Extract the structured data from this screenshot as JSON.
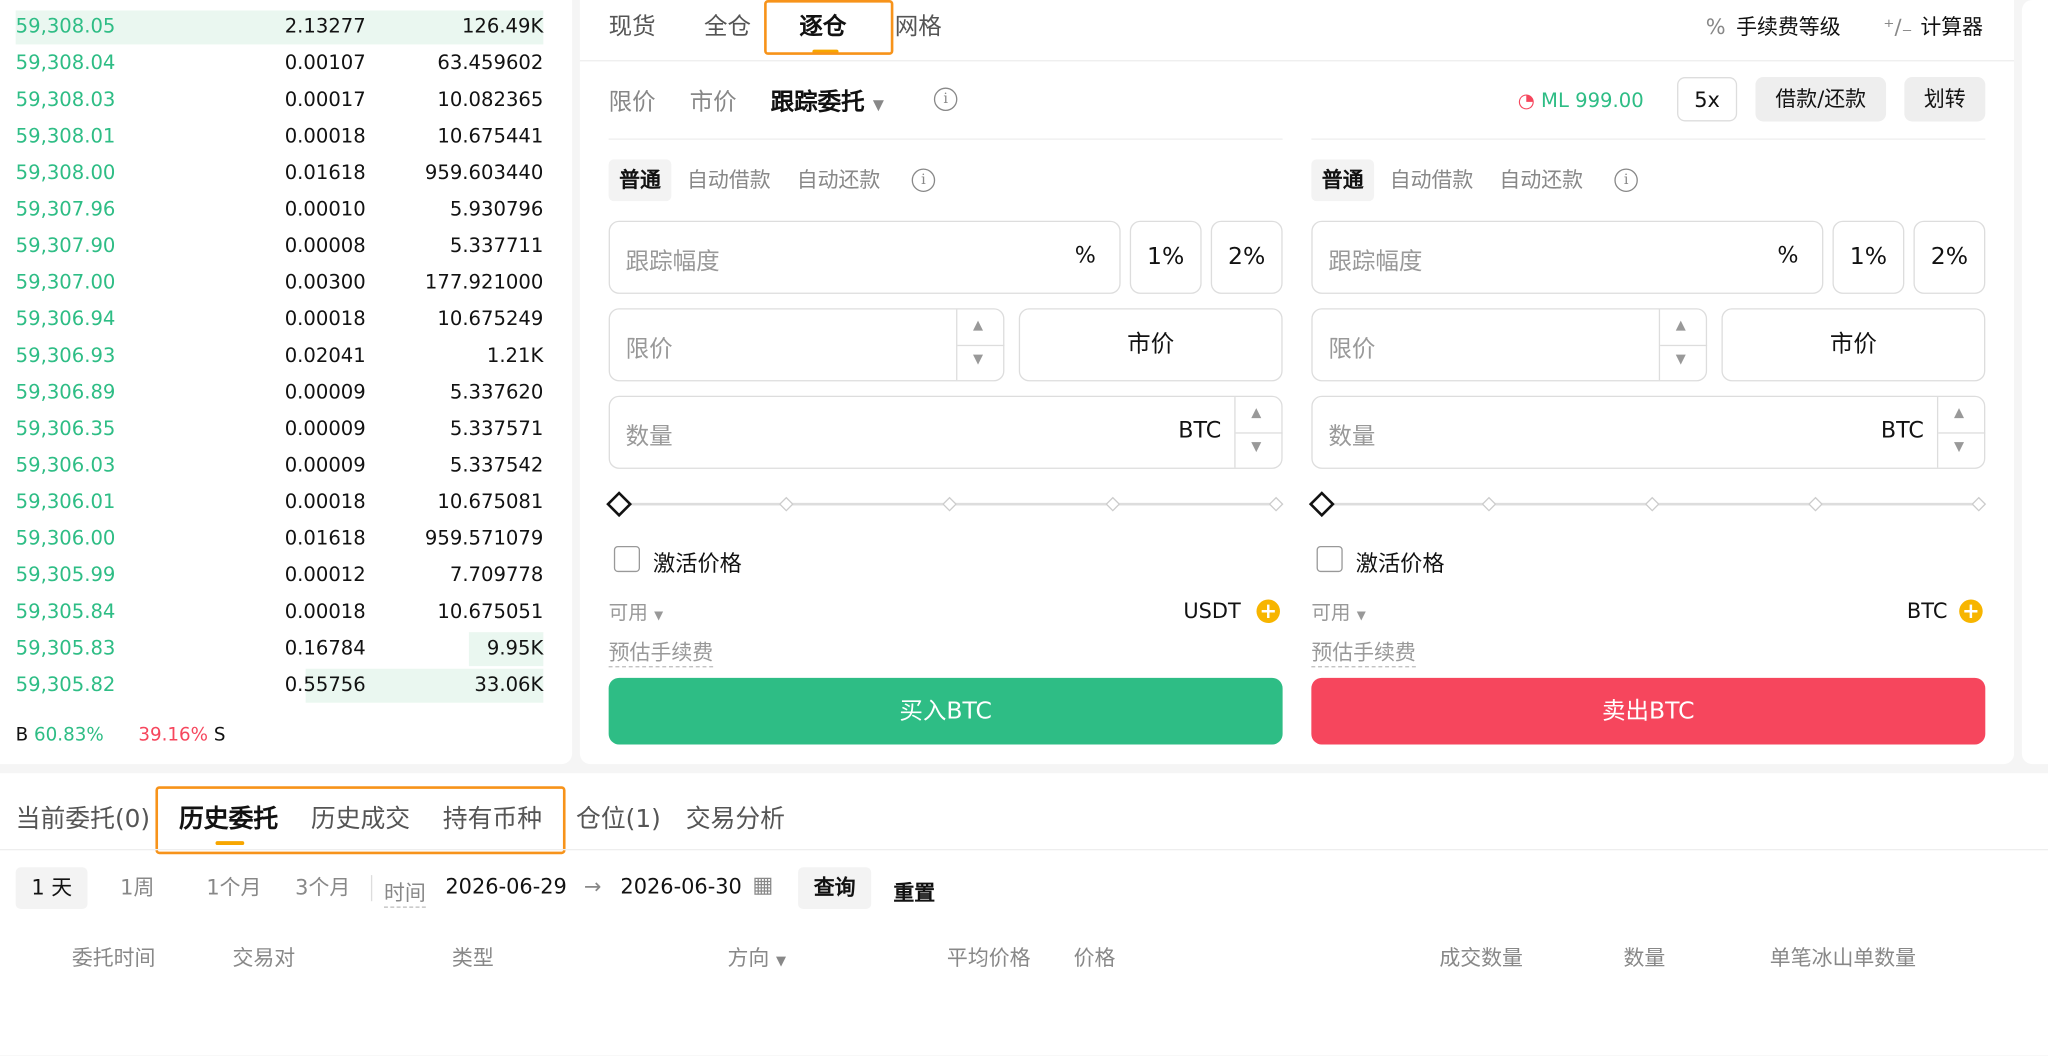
{
  "order_book": {
    "rows": [
      {
        "price": "59,308.05",
        "amount": "2.13277",
        "total": "126.49K",
        "depth": 1.0
      },
      {
        "price": "59,308.04",
        "amount": "0.00107",
        "total": "63.459602",
        "depth": 0
      },
      {
        "price": "59,308.03",
        "amount": "0.00017",
        "total": "10.082365",
        "depth": 0
      },
      {
        "price": "59,308.01",
        "amount": "0.00018",
        "total": "10.675441",
        "depth": 0
      },
      {
        "price": "59,308.00",
        "amount": "0.01618",
        "total": "959.603440",
        "depth": 0
      },
      {
        "price": "59,307.96",
        "amount": "0.00010",
        "total": "5.930796",
        "depth": 0
      },
      {
        "price": "59,307.90",
        "amount": "0.00008",
        "total": "5.337711",
        "depth": 0
      },
      {
        "price": "59,307.00",
        "amount": "0.00300",
        "total": "177.921000",
        "depth": 0
      },
      {
        "price": "59,306.94",
        "amount": "0.00018",
        "total": "10.675249",
        "depth": 0
      },
      {
        "price": "59,306.93",
        "amount": "0.02041",
        "total": "1.21K",
        "depth": 0
      },
      {
        "price": "59,306.89",
        "amount": "0.00009",
        "total": "5.337620",
        "depth": 0
      },
      {
        "price": "59,306.35",
        "amount": "0.00009",
        "total": "5.337571",
        "depth": 0
      },
      {
        "price": "59,306.03",
        "amount": "0.00009",
        "total": "5.337542",
        "depth": 0
      },
      {
        "price": "59,306.01",
        "amount": "0.00018",
        "total": "10.675081",
        "depth": 0
      },
      {
        "price": "59,306.00",
        "amount": "0.01618",
        "total": "959.571079",
        "depth": 0
      },
      {
        "price": "59,305.99",
        "amount": "0.00012",
        "total": "7.709778",
        "depth": 0
      },
      {
        "price": "59,305.84",
        "amount": "0.00018",
        "total": "10.675051",
        "depth": 0
      },
      {
        "price": "59,305.83",
        "amount": "0.16784",
        "total": "9.95K",
        "depth": 0.14
      },
      {
        "price": "59,305.82",
        "amount": "0.55756",
        "total": "33.06K",
        "depth": 0.45
      }
    ],
    "buy_label": "B",
    "buy_pct": "60.83%",
    "sell_pct": "39.16%",
    "sell_label": "S"
  },
  "trade": {
    "tabs": [
      "现货",
      "全仓",
      "逐仓",
      "网格"
    ],
    "fee_level": "手续费等级",
    "calculator": "计算器",
    "order_types": [
      "限价",
      "市价",
      "跟踪委托"
    ],
    "ml_value": "ML 999.00",
    "leverage": "5x",
    "borrow_repay": "借款/还款",
    "transfer": "划转",
    "modes": [
      "普通",
      "自动借款",
      "自动还款"
    ],
    "trail_placeholder": "跟踪幅度",
    "pct_unit": "%",
    "pct1": "1%",
    "pct2": "2%",
    "limit_placeholder": "限价",
    "market_label": "市价",
    "qty_placeholder": "数量",
    "qty_unit": "BTC",
    "activate_price": "激活价格",
    "available": "可用",
    "buy_avail_unit": "USDT",
    "sell_avail_unit": "BTC",
    "est_fee": "预估手续费",
    "buy_button": "买入BTC",
    "sell_button": "卖出BTC",
    "colors": {
      "buy": "#2ebd85",
      "sell": "#f6465d",
      "accent": "#f7a600"
    }
  },
  "bottom": {
    "tabs": [
      "当前委托(0)",
      "历史委托",
      "历史成交",
      "持有币种",
      "仓位(1)",
      "交易分析"
    ],
    "ranges": [
      "1 天",
      "1周",
      "1个月",
      "3个月"
    ],
    "time_label": "时间",
    "date_from": "2026-06-29",
    "date_arrow": "→",
    "date_to": "2026-06-30",
    "query": "查询",
    "reset": "重置",
    "columns": [
      "委托时间",
      "交易对",
      "类型",
      "方向",
      "平均价格",
      "价格",
      "成交数量",
      "数量",
      "单笔冰山单数量"
    ]
  }
}
